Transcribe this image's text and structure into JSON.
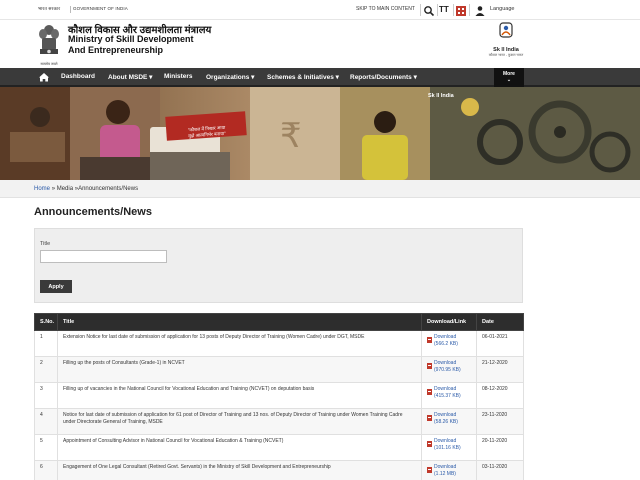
{
  "topbar": {
    "gov_hindi": "भारत सरकार",
    "gov_english": "GOVERNMENT OF INDIA",
    "skip_link": "SKIP TO MAIN CONTENT",
    "font_size_label": "TT",
    "language_label": "Language",
    "icons": [
      "search-icon",
      "text-size-icon",
      "sitemap-icon",
      "language-icon"
    ]
  },
  "header": {
    "title_hindi": "कौशल विकास और उद्यमशीलता मंत्रालय",
    "title_line1": "Ministry of Skill Development",
    "title_line2": "And Entrepreneurship",
    "emblem_caption": "सत्यमेव जयते",
    "logo_text": "Sk ll India",
    "logo_sub": "कौशल भारत - कुशल भारत"
  },
  "nav": {
    "items": [
      "Dashboard",
      "About MSDE",
      "Ministers",
      "Organizations",
      "Schemes & Initiatives",
      "Reports/Documents"
    ],
    "more_label": "More"
  },
  "banner": {
    "poster_line1": "\"कौशल में निखार आया",
    "poster_line2": "मुझे आत्मनिर्भर बनाया\"",
    "logo_text": "Sk ll India",
    "rupee": "₹"
  },
  "breadcrumb": {
    "home": "Home",
    "media": "Media",
    "current": "Announcements/News",
    "sep": "»"
  },
  "page": {
    "title": "Announcements/News"
  },
  "filter": {
    "title_label": "Title",
    "title_value": "",
    "apply_label": "Apply"
  },
  "table": {
    "headers": [
      "S.No.",
      "Title",
      "Download/Link",
      "Date"
    ],
    "rows": [
      {
        "sno": "1",
        "title": "Extension Notice for last date of submission of application for 13 posts of Deputy Director of Training (Women Cadre) under DGT, MSDE",
        "download": "Download",
        "size": "(566.2 KB)",
        "date": "06-01-2021"
      },
      {
        "sno": "2",
        "title": "Filling up the posts of Consultants (Grade-1) in NCVET",
        "download": "Download",
        "size": "(970.95 KB)",
        "date": "21-12-2020"
      },
      {
        "sno": "3",
        "title": "Filling up of vacancies in the National Council for Vocational Education and Training (NCVET) on deputation basis",
        "download": "Download",
        "size": "(415.37 KB)",
        "date": "08-12-2020"
      },
      {
        "sno": "4",
        "title": "Notice for last date of submission of application for 61 post of Director of Training and 13 nos. of Deputy Director of Training under Women Training Cadre under Directorate General of Training, MSDE",
        "download": "Download",
        "size": "(58.26 KB)",
        "date": "23-11-2020"
      },
      {
        "sno": "5",
        "title": "Appointment of Consulting Advisor in National Council for Vocational Education & Training (NCVET)",
        "download": "Download",
        "size": "(101.16 KB)",
        "date": "20-11-2020"
      },
      {
        "sno": "6",
        "title": "Engagement of One Legal Consultant (Retired Govt. Servants) in the Ministry of Skill Development and Entrepreneurship",
        "download": "Download",
        "size": "(1.12 MB)",
        "date": "03-11-2020"
      }
    ]
  },
  "colors": {
    "nav_bg": "#3a3a3a",
    "table_header_bg": "#2d2d2d",
    "link": "#2a5aa8",
    "pdf_icon": "#c0392b"
  }
}
